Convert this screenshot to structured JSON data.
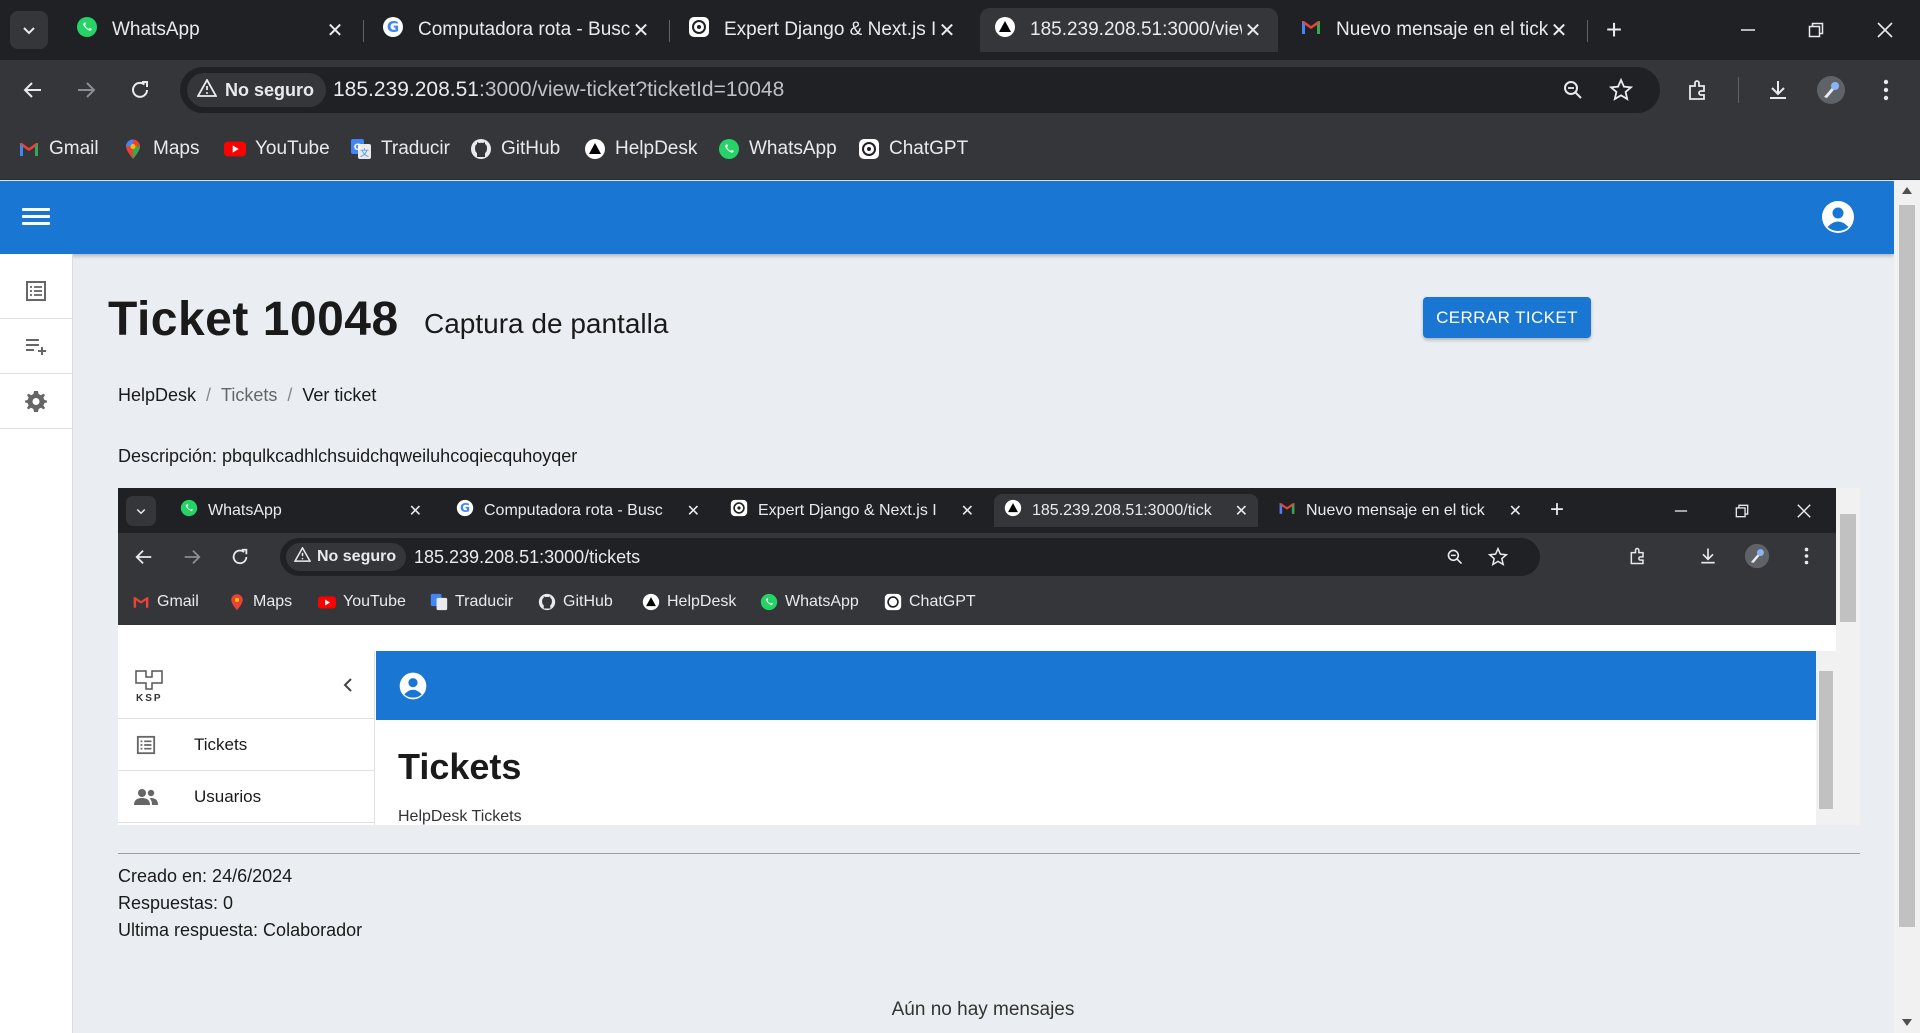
{
  "browser": {
    "tabs": [
      {
        "title": "WhatsApp",
        "icon": "whatsapp-icon"
      },
      {
        "title": "Computadora rota - Busc",
        "icon": "google-icon"
      },
      {
        "title": "Expert Django & Next.js I",
        "icon": "chatgpt-icon"
      },
      {
        "title": "185.239.208.51:3000/view",
        "icon": "helpdesk-icon"
      },
      {
        "title": "Nuevo mensaje en el tick",
        "icon": "gmail-icon"
      }
    ],
    "security_label": "No seguro",
    "url_host": "185.239.208.51",
    "url_rest": ":3000/view-ticket?ticketId=10048",
    "bookmarks": [
      {
        "label": "Gmail",
        "icon": "gmail-icon"
      },
      {
        "label": "Maps",
        "icon": "maps-icon"
      },
      {
        "label": "YouTube",
        "icon": "youtube-icon"
      },
      {
        "label": "Traducir",
        "icon": "translate-icon"
      },
      {
        "label": "GitHub",
        "icon": "github-icon"
      },
      {
        "label": "HelpDesk",
        "icon": "helpdesk-icon"
      },
      {
        "label": "WhatsApp",
        "icon": "whatsapp-icon"
      },
      {
        "label": "ChatGPT",
        "icon": "chatgpt-icon"
      }
    ]
  },
  "ticket": {
    "heading": "Ticket 10048",
    "subject": "Captura de pantalla",
    "close_button": "CERRAR TICKET",
    "breadcrumb": [
      "HelpDesk",
      "Tickets",
      "Ver ticket"
    ],
    "description": "Descripción: pbqulkcadhlchsuidchqweiluhcoqiecquhoyqer",
    "created": "Creado en: 24/6/2024",
    "replies": "Respuestas: 0",
    "last_reply": "Ultima respuesta: Colaborador",
    "empty_messages": "Aún no hay mensajes"
  },
  "screenshot": {
    "tabs": [
      {
        "title": "WhatsApp"
      },
      {
        "title": "Computadora rota - Busc"
      },
      {
        "title": "Expert Django & Next.js I"
      },
      {
        "title": "185.239.208.51:3000/tick"
      },
      {
        "title": "Nuevo mensaje en el tick"
      }
    ],
    "security_label": "No seguro",
    "url": "185.239.208.51:3000/tickets",
    "bookmarks": [
      "Gmail",
      "Maps",
      "YouTube",
      "Traducir",
      "GitHub",
      "HelpDesk",
      "WhatsApp",
      "ChatGPT"
    ],
    "logo_text": "KSP",
    "drawer_items": [
      "Tickets",
      "Usuarios"
    ],
    "page_title": "Tickets",
    "cut_text": "HelpDesk  Tickets"
  },
  "colors": {
    "primary": "#1976d2",
    "chrome_dark": "#202124",
    "chrome_mid": "#35363a",
    "page_bg": "#eaeef2"
  }
}
